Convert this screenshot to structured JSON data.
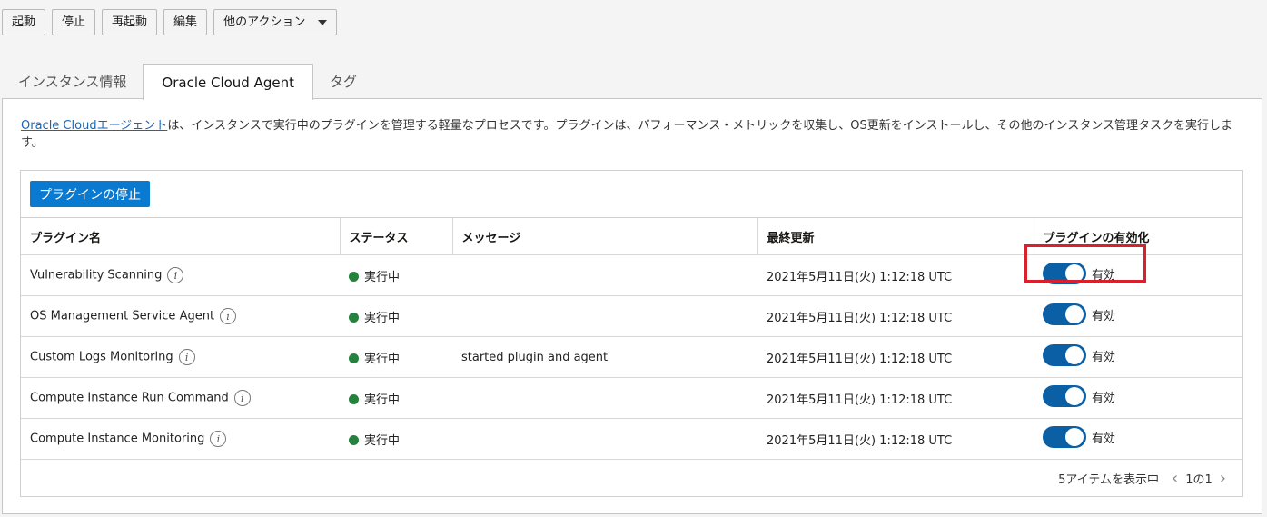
{
  "toolbar": {
    "start": "起動",
    "stop": "停止",
    "restart": "再起動",
    "edit": "編集",
    "more_actions": "他のアクション"
  },
  "tabs": [
    {
      "label": "インスタンス情報",
      "active": false
    },
    {
      "label": "Oracle Cloud Agent",
      "active": true
    },
    {
      "label": "タグ",
      "active": false
    }
  ],
  "intro": {
    "link_text": "Oracle Cloudエージェント",
    "text": "は、インスタンスで実行中のプラグインを管理する軽量なプロセスです。プラグインは、パフォーマンス・メトリックを収集し、OS更新をインストールし、その他のインスタンス管理タスクを実行します。"
  },
  "stop_plugins_button": "プラグインの停止",
  "table": {
    "headers": [
      "プラグイン名",
      "ステータス",
      "メッセージ",
      "最終更新",
      "プラグインの有効化"
    ],
    "rows": [
      {
        "name": "Vulnerability Scanning",
        "status": "実行中",
        "message": "",
        "updated": "2021年5月11日(火) 1:12:18 UTC",
        "toggle_label": "有効",
        "enabled": true
      },
      {
        "name": "OS Management Service Agent",
        "status": "実行中",
        "message": "",
        "updated": "2021年5月11日(火) 1:12:18 UTC",
        "toggle_label": "有効",
        "enabled": true
      },
      {
        "name": "Custom Logs Monitoring",
        "status": "実行中",
        "message": "started plugin and agent",
        "updated": "2021年5月11日(火) 1:12:18 UTC",
        "toggle_label": "有効",
        "enabled": true
      },
      {
        "name": "Compute Instance Run Command",
        "status": "実行中",
        "message": "",
        "updated": "2021年5月11日(火) 1:12:18 UTC",
        "toggle_label": "有効",
        "enabled": true
      },
      {
        "name": "Compute Instance Monitoring",
        "status": "実行中",
        "message": "",
        "updated": "2021年5月11日(火) 1:12:18 UTC",
        "toggle_label": "有効",
        "enabled": true
      }
    ]
  },
  "footer": {
    "count_text": "5アイテムを表示中",
    "page_text": "1の1"
  },
  "colors": {
    "status_running": "#26813e",
    "toggle_on": "#0b5fa5",
    "primary_button": "#0a7ad0",
    "highlight": "#d9202c",
    "link": "#1a66b3"
  },
  "icons": {
    "info": "info-icon",
    "dropdown": "caret-down-icon",
    "prev_page": "chevron-left-icon",
    "next_page": "chevron-right-icon"
  }
}
